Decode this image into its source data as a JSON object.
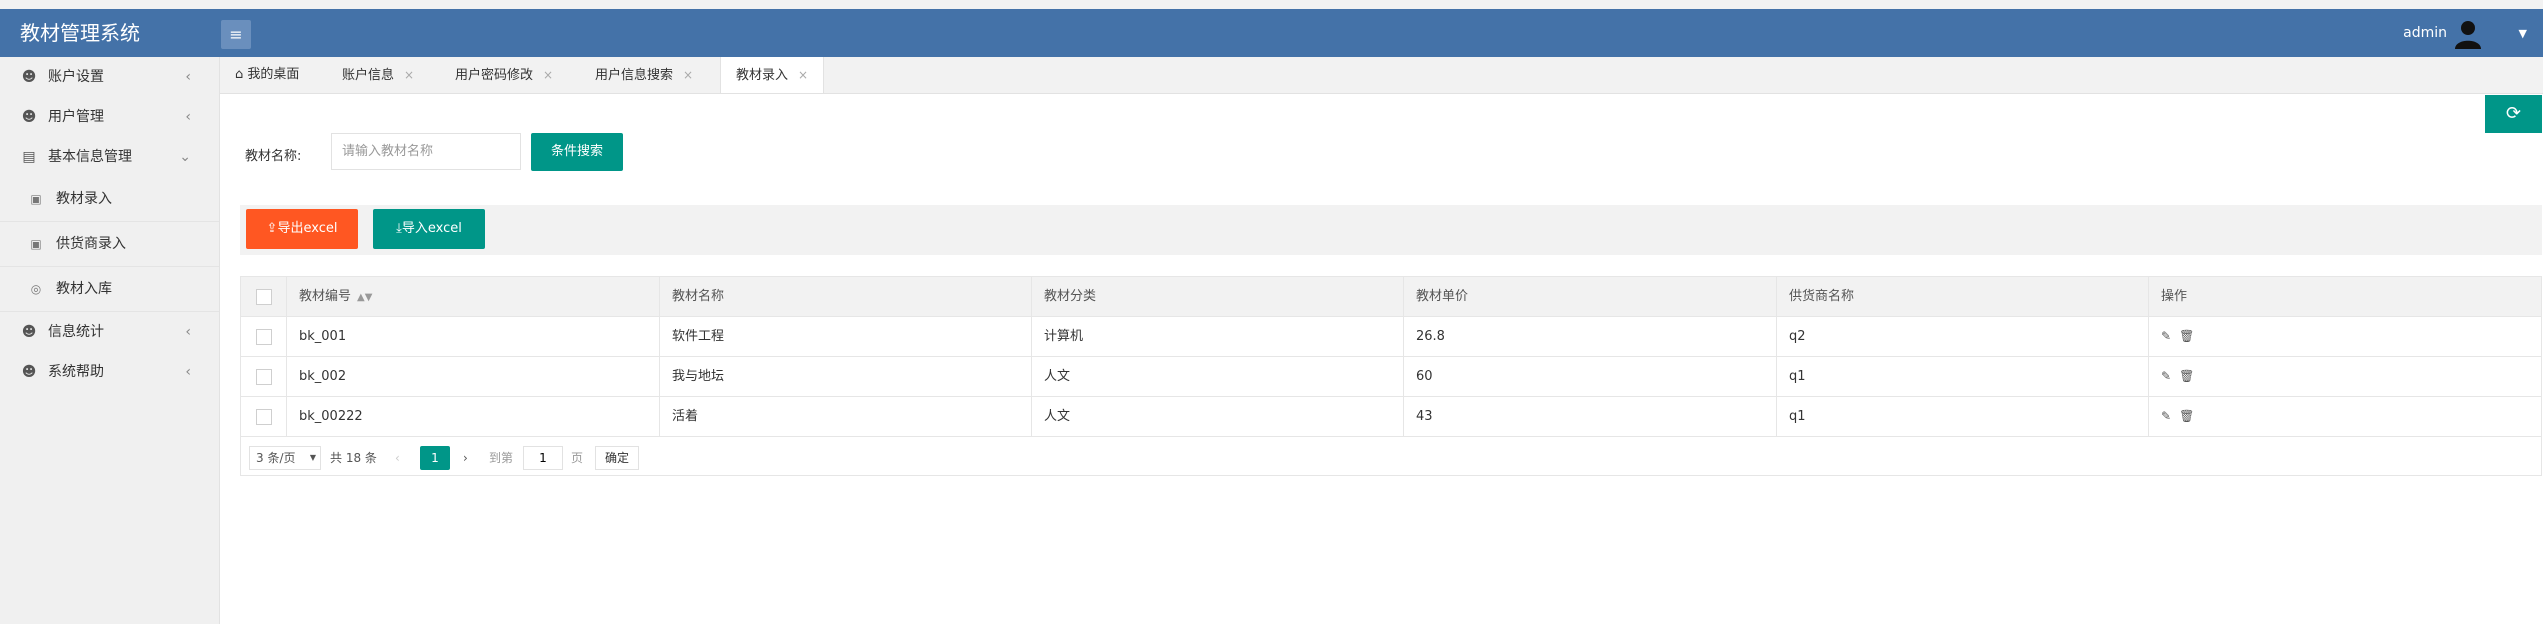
{
  "header": {
    "app_title": "教材管理系统",
    "username": "admin",
    "menu_icon": "hamburger-icon",
    "avatar_icon": "user-silhouette-icon"
  },
  "sidebar": {
    "items": [
      {
        "label": "账户设置",
        "icon": "user-outline-icon"
      },
      {
        "label": "用户管理",
        "icon": "user-outline-icon"
      },
      {
        "label": "基本信息管理",
        "icon": "grid-card-icon"
      },
      {
        "label": "信息统计",
        "icon": "user-outline-icon"
      },
      {
        "label": "系统帮助",
        "icon": "user-outline-icon"
      }
    ],
    "subitems": [
      {
        "label": "教材录入",
        "icon": "form-icon"
      },
      {
        "label": "供货商录入",
        "icon": "form-icon"
      },
      {
        "label": "教材入库",
        "icon": "database-icon"
      }
    ]
  },
  "tabs": [
    {
      "label": "我的桌面",
      "icon": "home-icon"
    },
    {
      "label": "账户信息"
    },
    {
      "label": "用户密码修改"
    },
    {
      "label": "用户信息搜索"
    },
    {
      "label": "教材录入"
    }
  ],
  "search": {
    "label": "教材名称:",
    "placeholder": "请输入教材名称",
    "button": "条件搜索"
  },
  "toolbar": {
    "export_label": "导出excel",
    "import_label": "导入excel"
  },
  "table": {
    "columns": [
      "教材编号",
      "教材名称",
      "教材分类",
      "教材单价",
      "供货商名称",
      "操作"
    ],
    "rows": [
      [
        "bk_001",
        "软件工程",
        "计算机",
        "26.8",
        "q2"
      ],
      [
        "bk_002",
        "我与地坛",
        "人文",
        "60",
        "q1"
      ],
      [
        "bk_00222",
        "活着",
        "人文",
        "43",
        "q1"
      ]
    ]
  },
  "pagination": {
    "page_size": "3 条/页",
    "total": "共 18 条",
    "current_page": "1",
    "goto_label": "到第",
    "goto_value": "1",
    "page_unit": "页",
    "confirm": "确定"
  },
  "colors": {
    "header_bg": "#4472a8",
    "primary": "#009688",
    "danger": "#ff5722"
  }
}
